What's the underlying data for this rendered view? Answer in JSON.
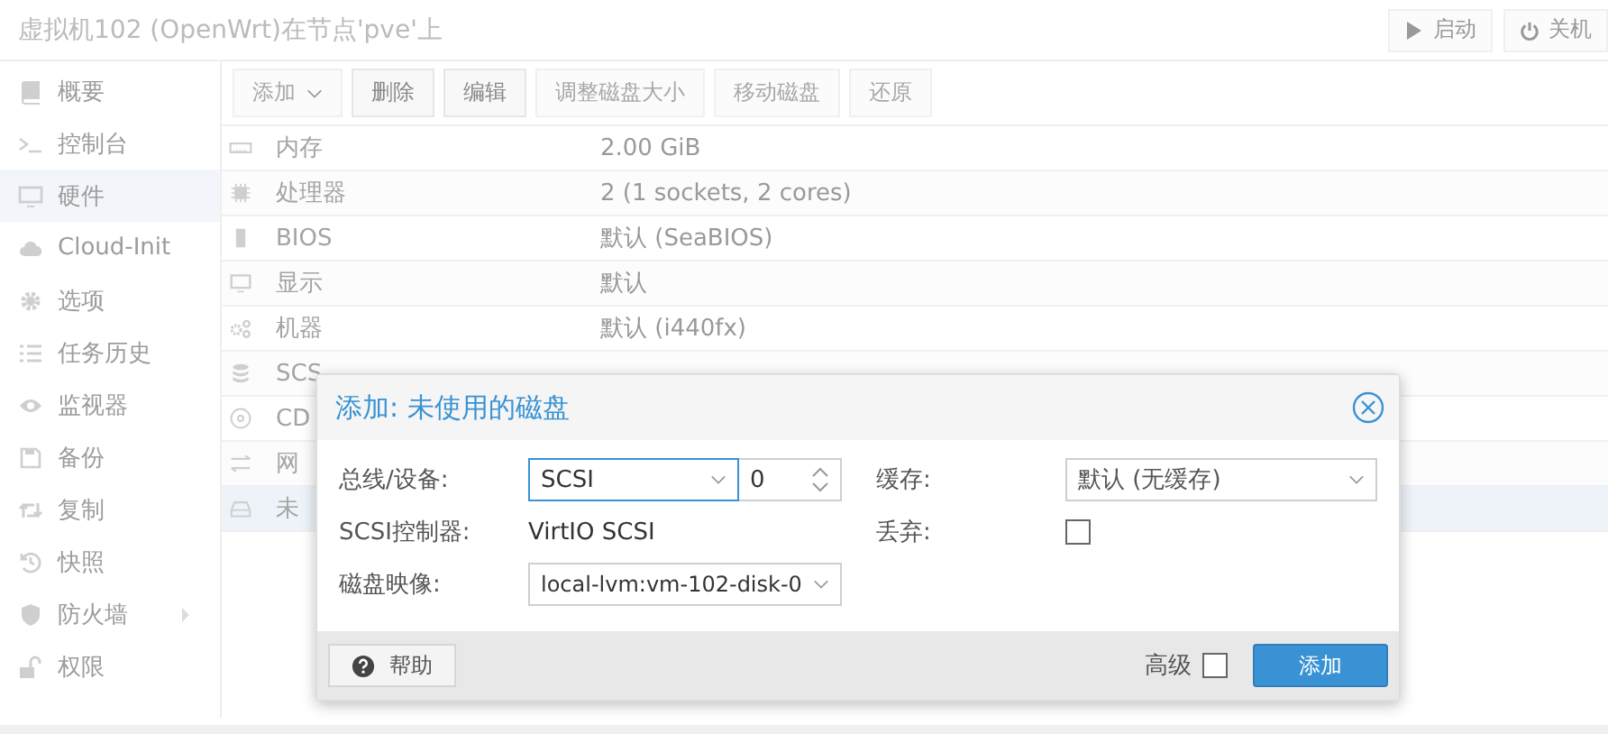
{
  "header": {
    "title": "虚拟机102 (OpenWrt)在节点'pve'上",
    "buttons": [
      {
        "kind": "start",
        "label": "启动",
        "disabled": true
      },
      {
        "kind": "shutdown",
        "label": "关机",
        "disabled": true
      }
    ]
  },
  "sidebar": {
    "items": [
      {
        "label": "概要",
        "selected": false
      },
      {
        "label": "控制台",
        "selected": false
      },
      {
        "label": "硬件",
        "selected": true
      },
      {
        "label": "Cloud-Init",
        "selected": false
      },
      {
        "label": "选项",
        "selected": false
      },
      {
        "label": "任务历史",
        "selected": false
      },
      {
        "label": "监视器",
        "selected": false
      },
      {
        "label": "备份",
        "selected": false
      },
      {
        "label": "复制",
        "selected": false
      },
      {
        "label": "快照",
        "selected": false
      },
      {
        "label": "防火墙",
        "selected": false,
        "expandable": true
      },
      {
        "label": "权限",
        "selected": false
      }
    ]
  },
  "toolbar": [
    {
      "label": "添加",
      "menu": true,
      "disabled": true
    },
    {
      "label": "删除",
      "disabled": false
    },
    {
      "label": "编辑",
      "disabled": false
    },
    {
      "label": "调整磁盘大小",
      "disabled": true
    },
    {
      "label": "移动磁盘",
      "disabled": true
    },
    {
      "label": "还原",
      "disabled": true
    }
  ],
  "hardware": {
    "rows": [
      {
        "label": "内存",
        "value": "2.00 GiB",
        "selected": false
      },
      {
        "label": "处理器",
        "value": "2 (1 sockets, 2 cores)",
        "selected": false
      },
      {
        "label": "BIOS",
        "value": "默认 (SeaBIOS)",
        "selected": false
      },
      {
        "label": "显示",
        "value": "默认",
        "selected": false
      },
      {
        "label": "机器",
        "value": "默认 (i440fx)",
        "selected": false
      },
      {
        "label": "SCS",
        "selected": false
      },
      {
        "label": "CD",
        "selected": false
      },
      {
        "label": "网",
        "selected": false
      },
      {
        "label": "未",
        "selected": true
      }
    ]
  },
  "dialog": {
    "title": "添加: 未使用的磁盘",
    "bus_label": "总线/设备:",
    "bus": "SCSI",
    "device": "0",
    "controller_label": "SCSI控制器:",
    "controller": "VirtIO SCSI",
    "image_label": "磁盘映像:",
    "image": "local-lvm:vm-102-disk-0",
    "cache_label": "缓存:",
    "cache": "默认 (无缓存)",
    "discard_label": "丢弃:",
    "discard": false,
    "help": "帮助",
    "advanced_label": "高级",
    "advanced": false,
    "add": "添加"
  }
}
